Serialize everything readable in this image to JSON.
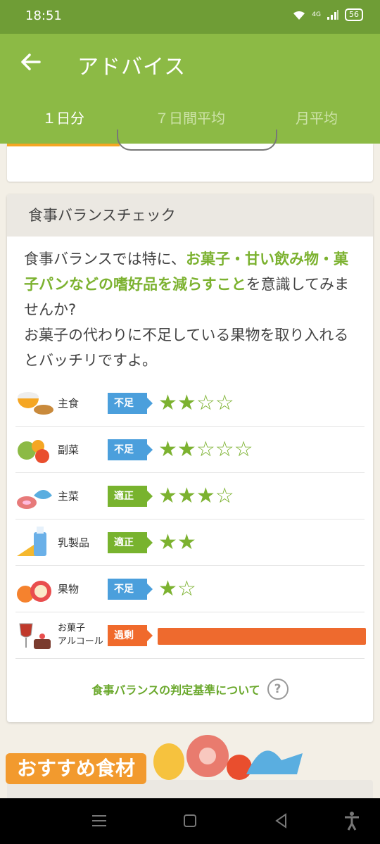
{
  "status": {
    "time": "18:51",
    "battery": "56",
    "network": "4G"
  },
  "appbar": {
    "title": "アドバイス"
  },
  "tabs": [
    {
      "label": "１日分",
      "active": true
    },
    {
      "label": "７日間平均",
      "active": false
    },
    {
      "label": "月平均",
      "active": false
    }
  ],
  "balance": {
    "header": "食事バランスチェック",
    "advice": {
      "p1": "食事バランスでは特に、",
      "highlight": "お菓子・甘い飲み物・菓子パンなどの嗜好品を減らすこと",
      "p2": "を意識してみませんか?",
      "p3": "お菓子の代わりに不足している果物を取り入れるとバッチリですよ。"
    },
    "rows": [
      {
        "label": "主食",
        "status": "不足",
        "filled": 2,
        "total": 4
      },
      {
        "label": "副菜",
        "status": "不足",
        "filled": 2,
        "total": 5
      },
      {
        "label": "主菜",
        "status": "適正",
        "filled": 3,
        "total": 4
      },
      {
        "label": "乳製品",
        "status": "適正",
        "filled": 2,
        "total": 2
      },
      {
        "label": "果物",
        "status": "不足",
        "filled": 1,
        "total": 2
      },
      {
        "label_line1": "お菓子",
        "label_line2": "アルコール",
        "status": "過剰"
      }
    ],
    "criteria_link": "食事バランスの判定基準について",
    "help_glyph": "?"
  },
  "recommend": {
    "label": "おすすめ食材"
  },
  "colors": {
    "green": "#8cba45",
    "short": "#4b9fdc",
    "ok": "#78b32e",
    "over": "#f06a2c"
  }
}
